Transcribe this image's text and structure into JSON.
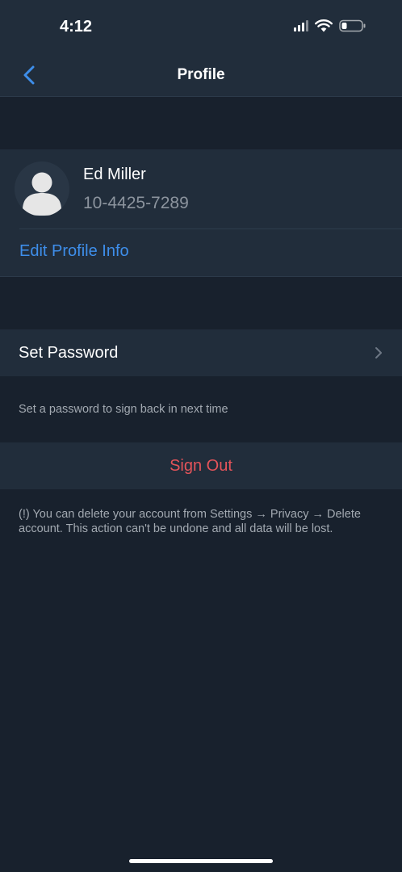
{
  "status_bar": {
    "time": "4:12"
  },
  "nav": {
    "title": "Profile",
    "back_icon": "chevron-left-icon"
  },
  "profile": {
    "name": "Ed Miller",
    "phone": "10-4425-7289",
    "edit_link": "Edit Profile Info",
    "avatar_icon": "person-icon"
  },
  "password": {
    "label": "Set Password",
    "hint": "Set a password to sign back in next time"
  },
  "sign_out": {
    "label": "Sign Out"
  },
  "delete_note": "(!) You can delete your account from Settings → Privacy → Delete account. This action can't be undone and all data will be lost.",
  "colors": {
    "background": "#18212d",
    "surface": "#212d3b",
    "accent": "#3e8eea",
    "danger": "#e5545a",
    "secondary_text": "#8c949e"
  }
}
